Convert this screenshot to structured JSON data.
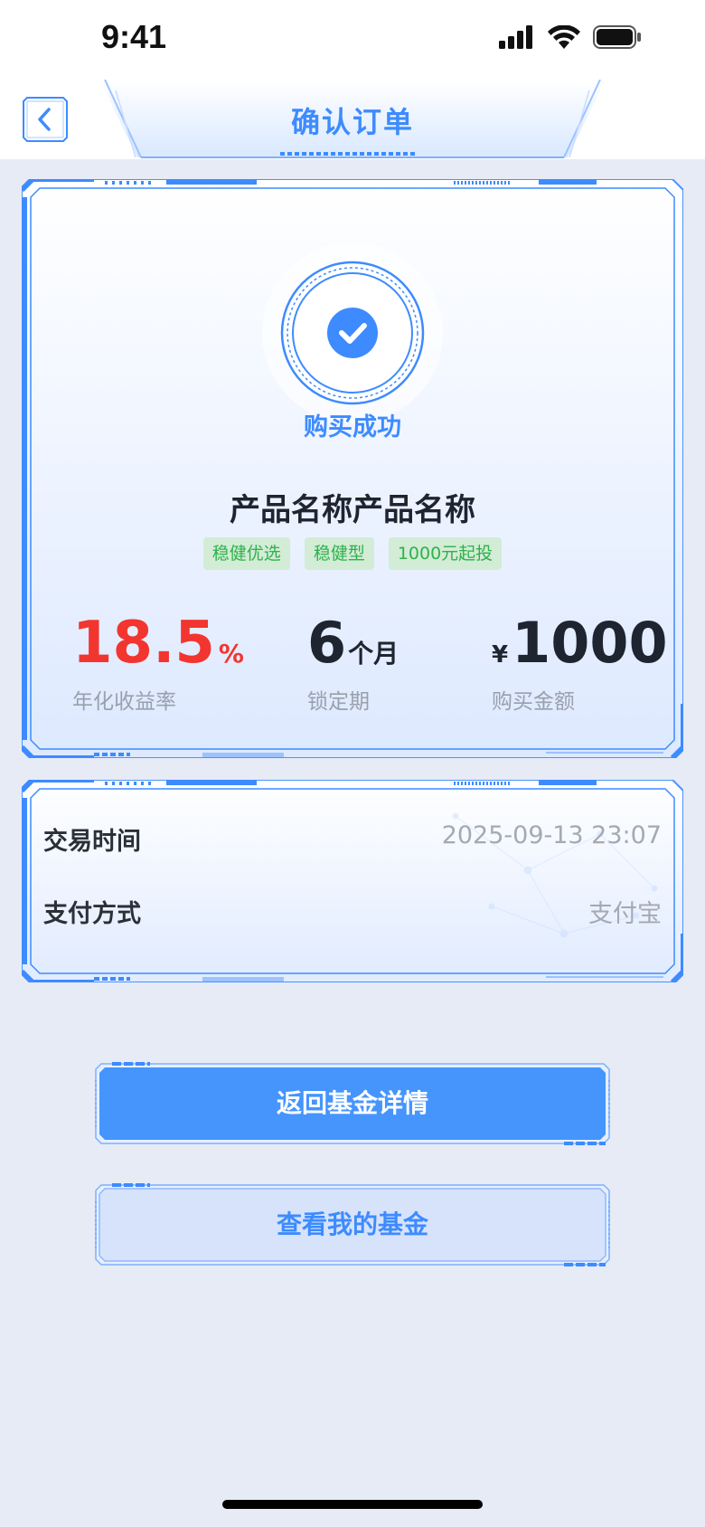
{
  "status_bar": {
    "time": "9:41",
    "icons": [
      "signal-icon",
      "wifi-icon",
      "battery-icon"
    ]
  },
  "nav": {
    "title": "确认订单",
    "back_icon": "chevron-left-icon"
  },
  "result": {
    "status_text": "购买成功",
    "icon": "check-circle-icon"
  },
  "product": {
    "name": "产品名称产品名称",
    "tags": [
      "稳健优选",
      "稳健型",
      "1000元起投"
    ],
    "metrics": {
      "rate": {
        "value": "18.5",
        "unit": "%",
        "label": "年化收益率"
      },
      "period": {
        "value": "6",
        "unit": "个月",
        "label": "锁定期"
      },
      "amount": {
        "currency": "¥",
        "value": "1000",
        "label": "购买金额"
      }
    }
  },
  "details": {
    "rows": [
      {
        "label": "交易时间",
        "value": "2025-09-13 23:07"
      },
      {
        "label": "支付方式",
        "value": "支付宝"
      }
    ]
  },
  "buttons": {
    "primary": "返回基金详情",
    "secondary": "查看我的基金"
  },
  "colors": {
    "accent": "#3d8bff",
    "rate_red": "#f3352f",
    "tag_green": "#2fb24a",
    "tag_bg": "#d2ecd6",
    "page_bg": "#e6ebf6"
  }
}
